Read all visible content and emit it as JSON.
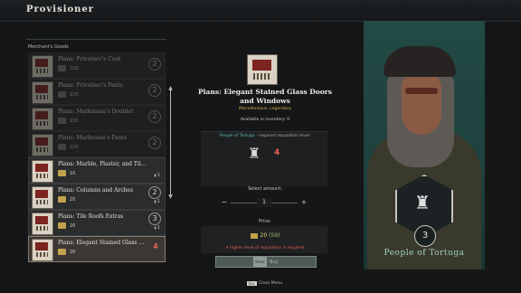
{
  "header": {
    "title": "Provisioner"
  },
  "goods": {
    "heading": "Merchant's Goods",
    "items": [
      {
        "name": "Plans: Privateer's Coat",
        "price": "220",
        "badge": "2",
        "locked": true,
        "owned": ""
      },
      {
        "name": "Plans: Privateer's Pants",
        "price": "220",
        "badge": "2",
        "locked": true,
        "owned": ""
      },
      {
        "name": "Plans: Marksman's Doublet",
        "price": "220",
        "badge": "2",
        "locked": true,
        "owned": ""
      },
      {
        "name": "Plans: Marksman's Pants",
        "price": "220",
        "badge": "2",
        "locked": true,
        "owned": ""
      },
      {
        "name": "Plans: Marble, Plaster, and Tile. Ba...",
        "price": "10",
        "badge": "",
        "locked": false,
        "owned": "1"
      },
      {
        "name": "Plans: Columns and Arches",
        "price": "20",
        "badge": "2",
        "locked": false,
        "owned": "1"
      },
      {
        "name": "Plans: Tile Roofs Extras",
        "price": "20",
        "badge": "3",
        "locked": false,
        "owned": "1"
      },
      {
        "name": "Plans: Elegant Stained Glass Doors...",
        "price": "20",
        "badge": "4",
        "locked": false,
        "owned": "",
        "selected": true
      }
    ]
  },
  "detail": {
    "title": "Plans: Elegant Stained Glass Doors and Windows",
    "type": "Miscellaneous, Legendary",
    "inventory": "Available in inventory: 0",
    "rep_faction": "People of Tortuga",
    "rep_text": " - required reputation level:",
    "rep_level": "4",
    "select_label": "Select amount:",
    "quantity": "1",
    "price_label": "Price:",
    "price": "20",
    "price_owned": "(59)",
    "warning": "A higher level of reputation is required",
    "buy_key": "Enter",
    "buy_label": "Buy"
  },
  "faction": {
    "name": "People of Tortuga",
    "level": "3"
  },
  "footer": {
    "close_key": "Esc",
    "close_label": "Close Menu"
  }
}
